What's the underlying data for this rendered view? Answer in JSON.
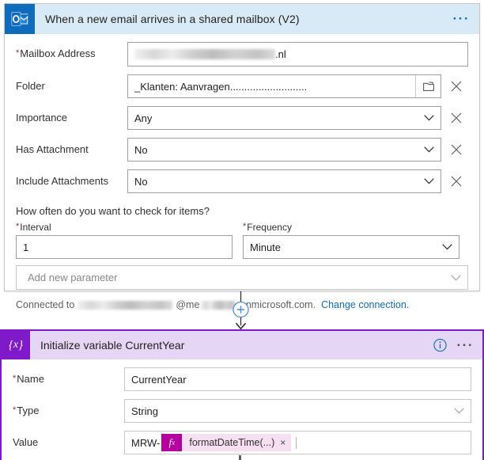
{
  "trigger": {
    "icon": "outlook-icon",
    "title": "When a new email arrives in a shared mailbox (V2)",
    "menu_label": "···",
    "fields": [
      {
        "label": "Mailbox Address",
        "required": true,
        "value": ".nl",
        "redacted": true,
        "control": "text",
        "deletable": false
      },
      {
        "label": "Folder",
        "required": false,
        "value": "_Klanten: Aanvragen...........................",
        "redacted": false,
        "control": "folder-picker",
        "deletable": true
      },
      {
        "label": "Importance",
        "required": false,
        "value": "Any",
        "redacted": false,
        "control": "dropdown",
        "deletable": true
      },
      {
        "label": "Has Attachment",
        "required": false,
        "value": "No",
        "redacted": false,
        "control": "dropdown",
        "deletable": true
      },
      {
        "label": "Include Attachments",
        "required": false,
        "value": "No",
        "redacted": false,
        "control": "dropdown",
        "deletable": true
      }
    ],
    "recurrence": {
      "question": "How often do you want to check for items?",
      "interval_label": "Interval",
      "interval_value": "1",
      "frequency_label": "Frequency",
      "frequency_value": "Minute"
    },
    "add_parameter_label": "Add new parameter",
    "connection": {
      "prefix": "Connected to",
      "at": "@me",
      "suffix": ".onmicrosoft.com.",
      "change_link": "Change connection."
    }
  },
  "connector": {
    "add_button_label": "+",
    "accent": "#4f8fd6"
  },
  "initvar": {
    "icon": "variable-braces-icon",
    "title": "Initialize variable CurrentYear",
    "info_label": "i",
    "menu_label": "···",
    "accent": "#8019c9",
    "header_bg": "#e6d6f5",
    "fields": [
      {
        "label": "Name",
        "required": true,
        "value": "CurrentYear",
        "control": "text"
      },
      {
        "label": "Type",
        "required": true,
        "value": "String",
        "control": "dropdown"
      },
      {
        "label": "Value",
        "required": false,
        "value": "MRW-",
        "control": "token-text",
        "token": {
          "fx": "fx",
          "name": "formatDateTime(...)",
          "remove": "×"
        }
      }
    ]
  }
}
